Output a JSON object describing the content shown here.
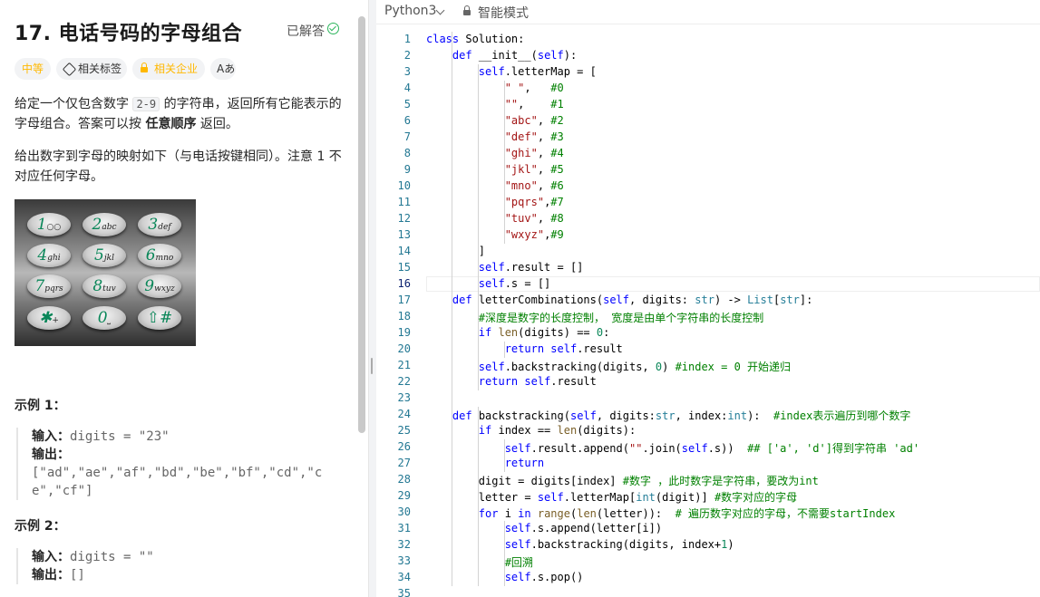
{
  "problem": {
    "title": "17. 电话号码的字母组合",
    "status_label": "已解答",
    "difficulty": "中等",
    "tags_label": "相关标签",
    "company_label": "相关企业",
    "font_label": "Aあ",
    "desc1_a": "给定一个仅包含数字 ",
    "desc1_code": "2-9",
    "desc1_b": " 的字符串，返回所有它能表示的字母组合。答案可以按 ",
    "desc1_bold": "任意顺序",
    "desc1_c": " 返回。",
    "desc2": "给出数字到字母的映射如下（与电话按键相同）。注意 1 不对应任何字母。",
    "keypad": [
      {
        "n": "1",
        "l": "○○"
      },
      {
        "n": "2",
        "l": "abc"
      },
      {
        "n": "3",
        "l": "def"
      },
      {
        "n": "4",
        "l": "ghi"
      },
      {
        "n": "5",
        "l": "jkl"
      },
      {
        "n": "6",
        "l": "mno"
      },
      {
        "n": "7",
        "l": "pqrs"
      },
      {
        "n": "8",
        "l": "tuv"
      },
      {
        "n": "9",
        "l": "wxyz"
      },
      {
        "n": "✱",
        "l": "+"
      },
      {
        "n": "0",
        "l": "⎵"
      },
      {
        "n": "⇧#",
        "l": ""
      }
    ],
    "example1_title": "示例 1：",
    "input_label": "输入：",
    "output_label": "输出：",
    "example1_input": "digits = \"23\"",
    "example1_output": "[\"ad\",\"ae\",\"af\",\"bd\",\"be\",\"bf\",\"cd\",\"ce\",\"cf\"]",
    "example2_title": "示例 2：",
    "example2_input": "digits = \"\"",
    "example2_output": "[]"
  },
  "editor": {
    "language": "Python3",
    "mode": "智能模式",
    "current_line": 16,
    "lines": [
      "class Solution:",
      "    def __init__(self):",
      "        self.letterMap = [",
      "            \" \",   #0",
      "            \"\",    #1",
      "            \"abc\", #2",
      "            \"def\", #3",
      "            \"ghi\", #4",
      "            \"jkl\", #5",
      "            \"mno\", #6",
      "            \"pqrs\",#7",
      "            \"tuv\", #8",
      "            \"wxyz\",#9",
      "        ]",
      "        self.result = []",
      "        self.s = []",
      "    def letterCombinations(self, digits: str) -> List[str]:",
      "        #深度是数字的长度控制， 宽度是由单个字符串的长度控制",
      "        if len(digits) == 0:",
      "            return self.result",
      "        self.backstracking(digits, 0) #index = 0 开始递归",
      "        return self.result",
      "",
      "    def backstracking(self, digits:str, index:int):  #index表示遍历到哪个数字",
      "        if index == len(digits):",
      "            self.result.append(\"\".join(self.s))  ## ['a', 'd']得到字符串 'ad'",
      "            return",
      "        digit = digits[index] #数字 ，此时数字是字符串，要改为int",
      "        letter = self.letterMap[int(digit)] #数字对应的字母",
      "        for i in range(len(letter)):  # 遍历数字对应的字母，不需要startIndex",
      "            self.s.append(letter[i])",
      "            self.backstracking(digits, index+1)",
      "            #回溯",
      "            self.s.pop()",
      ""
    ]
  }
}
